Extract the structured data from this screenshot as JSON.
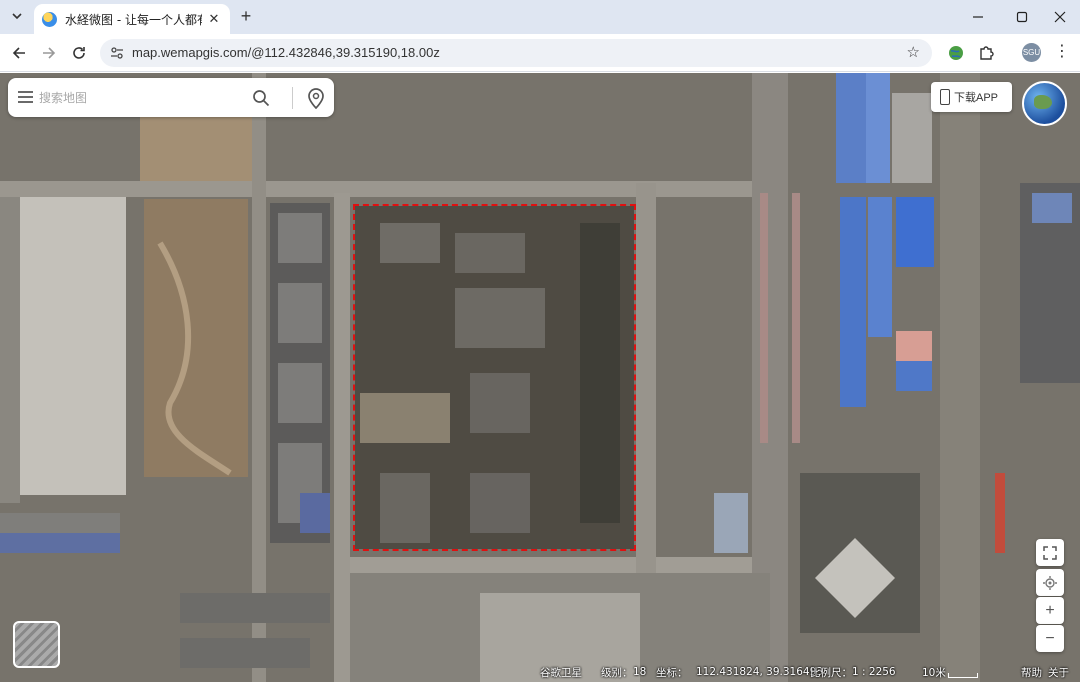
{
  "browser": {
    "tab": {
      "title": "水経微图 - 让每一个人都有自己"
    },
    "url": "map.wemapgis.com/@112.432846,39.315190,18.00z",
    "profile_initials": "SGU"
  },
  "map": {
    "search": {
      "placeholder": "搜索地图"
    },
    "download_app": "下载APP",
    "status": {
      "layer": "谷歌卫星",
      "level_label": "级别：",
      "level": "18",
      "coord_label": "坐标：",
      "coord": "112.431824, 39.316493",
      "scale_label": "比例尺：",
      "scale": "1 : 2256",
      "scale_text": "10米",
      "help": "帮助",
      "about": "关于"
    },
    "colors": {
      "selection": "#e01010"
    }
  }
}
